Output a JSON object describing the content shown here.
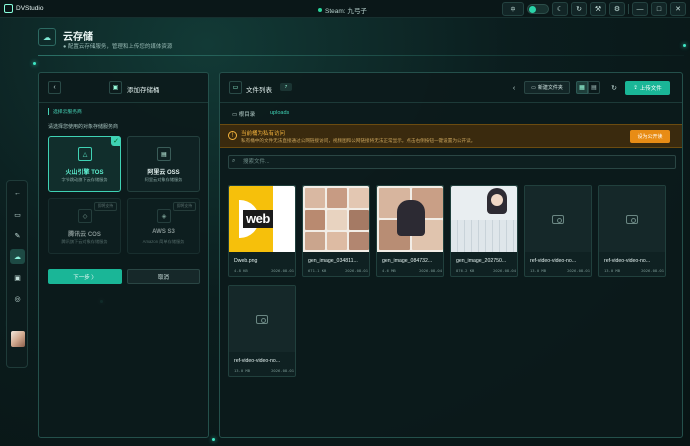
{
  "app": {
    "title": "DVStudio",
    "status_text": "Steam: 九弓子"
  },
  "topbar": {
    "buttons": [
      {
        "name": "lang-button",
        "label": "中"
      },
      {
        "name": "theme-toggle",
        "label": ""
      },
      {
        "name": "moon-button",
        "label": "☾"
      },
      {
        "name": "refresh-button",
        "label": "↻"
      },
      {
        "name": "tools-button",
        "label": "⚒"
      },
      {
        "name": "settings-button",
        "label": "⚙"
      },
      {
        "name": "minimize-button",
        "label": "—"
      },
      {
        "name": "maximize-button",
        "label": "□"
      },
      {
        "name": "close-button",
        "label": "✕"
      }
    ]
  },
  "header": {
    "title": "云存储",
    "subtitle": "● 配置云存储服务，管理和上传您的媒体资源"
  },
  "rail": {
    "icons": [
      "←",
      "▭",
      "✎",
      "☁",
      "▣",
      "◎"
    ]
  },
  "left_panel": {
    "title": "添加存储桶",
    "section": "选择云服务商",
    "description": "请选择您使用的对象存储服务商",
    "providers": [
      {
        "name": "火山引擎 TOS",
        "desc": "字节跳动旗下云存储服务",
        "logo": "△",
        "selected": true,
        "badge": ""
      },
      {
        "name": "阿里云 OSS",
        "desc": "阿里云对象存储服务",
        "logo": "▤",
        "selected": false,
        "badge": ""
      },
      {
        "name": "腾讯云 COS",
        "desc": "腾讯旗下云对象存储服务",
        "logo": "◇",
        "selected": false,
        "badge": "即将支持",
        "disabled": true
      },
      {
        "name": "AWS S3",
        "desc": "Amazon 简单存储服务",
        "logo": "◈",
        "selected": false,
        "badge": "即将支持",
        "disabled": true
      }
    ],
    "next_label": "下一步 〉",
    "cancel_label": "取消"
  },
  "right_panel": {
    "title": "文件列表",
    "count": "7",
    "new_folder_label": "新建文件夹",
    "upload_label": "上传文件",
    "breadcrumb_root": "根目录",
    "breadcrumb_current": "uploads",
    "warning": {
      "title": "当前桶为私有访问",
      "desc": "私有桶中的文件无法直接通过公网链接访问，视频图和公网链接将无法正常显示。点击右侧按钮一键设置为公开读。",
      "button": "设为公开读"
    },
    "search_placeholder": "搜索文件...",
    "files": [
      {
        "name": "Dweb.png",
        "size": "4.8 KB",
        "date": "2026-08-01",
        "type": "logo"
      },
      {
        "name": "gen_image_034811...",
        "size": "671.1 KB",
        "date": "2026-08-01",
        "type": "image-grid"
      },
      {
        "name": "gen_image_084732...",
        "size": "4.6 MB",
        "date": "2026-08-04",
        "type": "image-portrait"
      },
      {
        "name": "gen_image_202750...",
        "size": "876.2 KB",
        "date": "2026-08-04",
        "type": "image-room"
      },
      {
        "name": "ref-video-video-no...",
        "size": "13.0 MB",
        "date": "2026-08-01",
        "type": "video"
      },
      {
        "name": "ref-video-video-no...",
        "size": "13.0 MB",
        "date": "2026-08-01",
        "type": "video"
      },
      {
        "name": "ref-video-video-no...",
        "size": "13.0 MB",
        "date": "2026-08-01",
        "type": "video"
      }
    ]
  },
  "colors": {
    "accent": "#1ab697",
    "warning": "#e88c15",
    "background": "#0b1d1e"
  }
}
